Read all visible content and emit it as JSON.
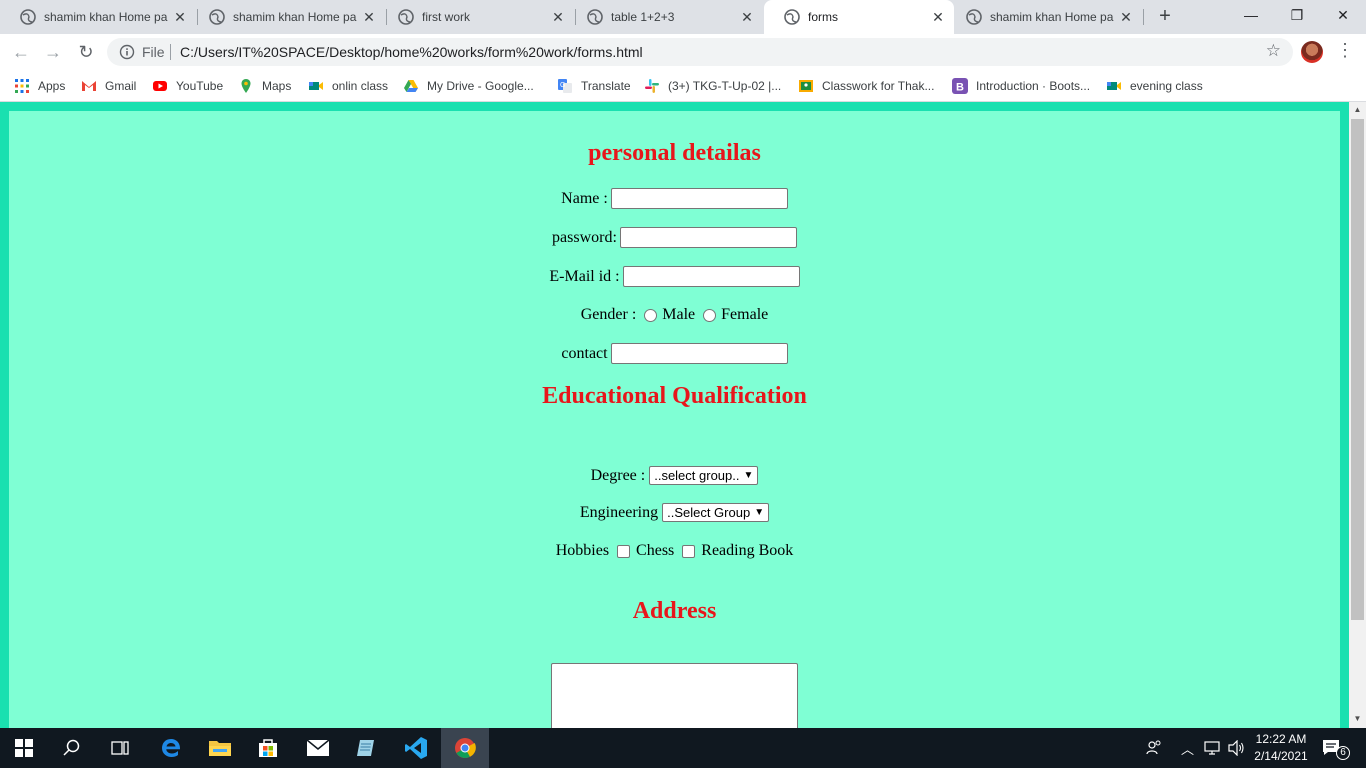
{
  "tabs": [
    {
      "title": "shamim khan Home pa"
    },
    {
      "title": "shamim khan Home pa"
    },
    {
      "title": "first work"
    },
    {
      "title": "table 1+2+3"
    },
    {
      "title": "forms"
    },
    {
      "title": "shamim khan Home pa"
    }
  ],
  "new_tab": "+",
  "window": {
    "minimize": "—",
    "restore": "❐",
    "close": "✕"
  },
  "toolbar": {
    "back": "←",
    "forward": "→",
    "reload": "↻",
    "scheme_label": "File",
    "url": "C:/Users/IT%20SPACE/Desktop/home%20works/form%20work/forms.html",
    "star": "☆",
    "menu": "⋮"
  },
  "bookmarks": [
    {
      "label": "Apps",
      "icon": "apps-grid-icon",
      "color": "#1a73e8"
    },
    {
      "label": "Gmail",
      "icon": "gmail-icon",
      "color": "#ea4335"
    },
    {
      "label": "YouTube",
      "icon": "youtube-icon",
      "color": "#ff0000"
    },
    {
      "label": "Maps",
      "icon": "maps-icon",
      "color": "#34a853"
    },
    {
      "label": "onlin class",
      "icon": "meet-icon",
      "color": "#00897b"
    },
    {
      "label": "My Drive - Google...",
      "icon": "drive-icon",
      "color": "#fbbc04"
    },
    {
      "label": "Translate",
      "icon": "translate-icon",
      "color": "#4285f4"
    },
    {
      "label": "(3+) TKG-T-Up-02 |...",
      "icon": "slack-icon",
      "color": "#e01e5a"
    },
    {
      "label": "Classwork for Thak...",
      "icon": "classroom-icon",
      "color": "#f9ab00"
    },
    {
      "label": "Introduction · Boots...",
      "icon": "bootstrap-icon",
      "color": "#7952b3"
    },
    {
      "label": "evening class",
      "icon": "meet-icon",
      "color": "#00897b"
    }
  ],
  "form": {
    "heading_personal": "personal detailas",
    "name_label": "Name :",
    "password_label": "password:",
    "email_label": "E-Mail id :",
    "gender_label": "Gender :",
    "gender_male": "Male",
    "gender_female": "Female",
    "contact_label": "contact",
    "heading_education": "Educational Qualification",
    "degree_label": "Degree :",
    "degree_selected": "..select group..",
    "engineering_label": "Engineering",
    "engineering_selected": "..Select Group",
    "hobbies_label": "Hobbies",
    "hobby_chess": "Chess",
    "hobby_reading": "Reading Book",
    "heading_address": "Address"
  },
  "colors": {
    "heading": "#e8161b",
    "page_bg": "#7fffd4",
    "page_border": "#1ae0b0"
  },
  "taskbar": {
    "time": "12:22 AM",
    "date": "2/14/2021",
    "notification_count": "6"
  }
}
